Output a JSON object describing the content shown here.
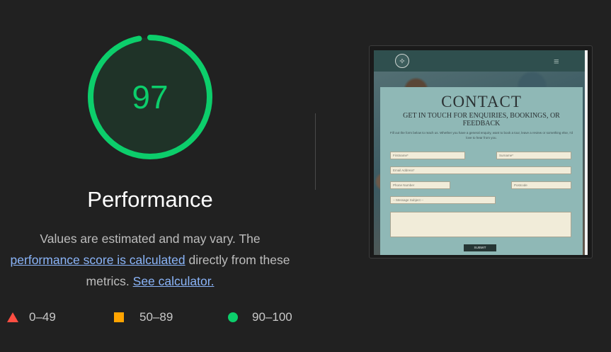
{
  "colors": {
    "pass": "#0cce6b",
    "average": "#ffa400",
    "fail": "#ff4e42",
    "link": "#8ab4f8"
  },
  "gauge": {
    "score": "97",
    "fraction": 0.97
  },
  "category": {
    "title": "Performance"
  },
  "description": {
    "prefix": "Values are estimated and may vary. The",
    "link1": "performance score is calculated",
    "middle": "directly from these metrics.",
    "link2": "See calculator."
  },
  "legend": [
    {
      "icon": "triangle-icon",
      "label": "0–49"
    },
    {
      "icon": "square-icon",
      "label": "50–89"
    },
    {
      "icon": "circle-icon",
      "label": "90–100"
    }
  ],
  "screenshot": {
    "nav": {
      "logo_icon": "circular-logo",
      "menu_icon": "hamburger-menu-icon",
      "menu_glyph": "≡",
      "logo_glyph": "✧"
    },
    "heading": "CONTACT",
    "subheading": "GET IN TOUCH FOR ENQUIRIES, BOOKINGS, OR FEEDBACK",
    "intro": "Fill out the form below to reach us. Whether you have a general enquiry, want to book a tour, leave a review or something else, I'd love to hear from you.",
    "fields": {
      "firstname": "Firstname*",
      "surname": "Surname*",
      "email": "Email Address*",
      "phone": "Phone Number",
      "postcode": "Postcode",
      "subject": "-- Message Subject --"
    },
    "submit": "SUBMIT"
  }
}
